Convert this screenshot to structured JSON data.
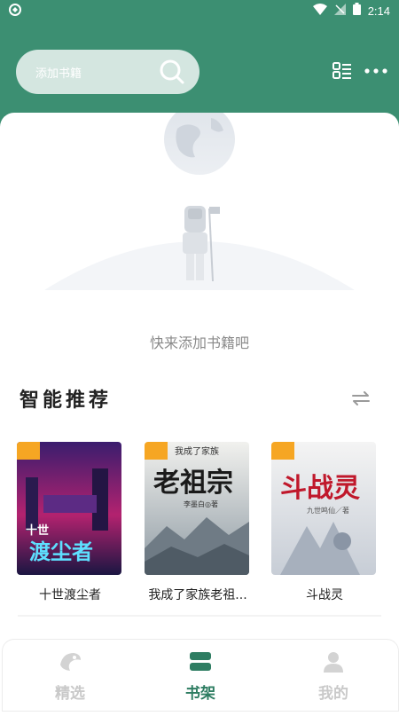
{
  "status_bar": {
    "time": "2:14"
  },
  "header": {
    "search_placeholder": "添加书籍"
  },
  "empty_state": {
    "text": "快来添加书籍吧"
  },
  "recommend": {
    "title": "智能推荐",
    "books": [
      {
        "title": "十世渡尘者",
        "cover_text": "渡尘者",
        "cover_top": "十世"
      },
      {
        "title": "我成了家族老祖...",
        "cover_text": "老祖宗",
        "cover_top": "我成了家族",
        "cover_author": "李墨白◎著"
      },
      {
        "title": "斗战灵",
        "cover_text": "斗战灵",
        "cover_author": "九世鸣仙／著"
      }
    ]
  },
  "tabs": [
    {
      "label": "精选",
      "active": false
    },
    {
      "label": "书架",
      "active": true
    },
    {
      "label": "我的",
      "active": false
    }
  ],
  "colors": {
    "brand": "#3c8f72",
    "active_tab": "#2e7d62"
  }
}
